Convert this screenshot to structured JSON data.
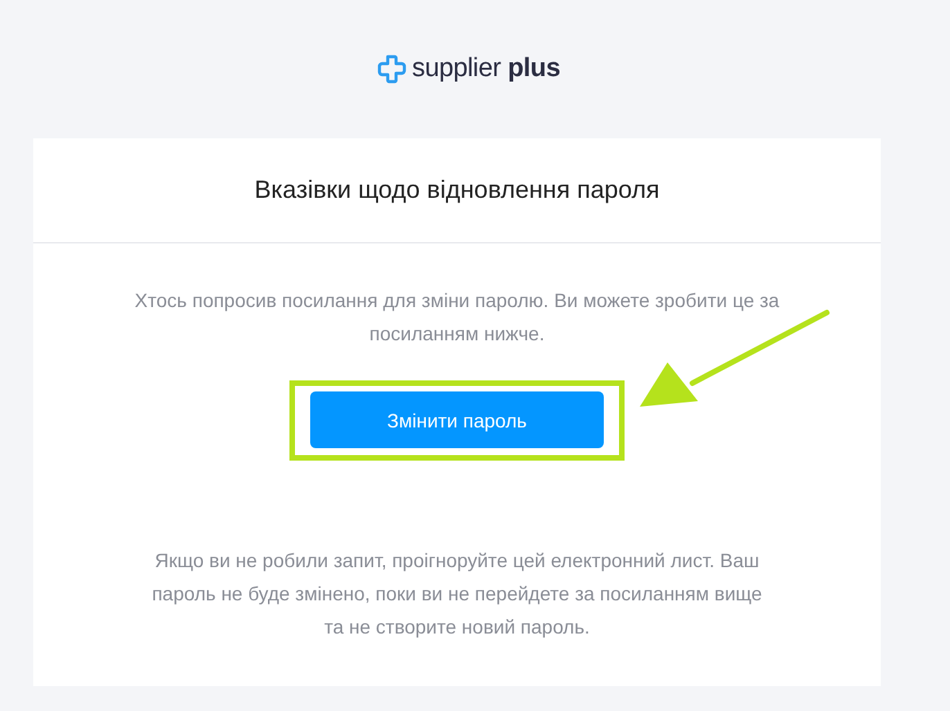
{
  "logo": {
    "text": "supplier **plus**"
  },
  "card": {
    "title": "Вказівки щодо відновлення пароля",
    "intro": "Хтось попросив посилання для зміни паролю. Ви можете зробити це за посиланням нижче.",
    "button": "Змінити пароль",
    "note": "Якщо ви не робили запит, проігноруйте цей електронний лист. Ваш пароль не буде змінено, поки ви не перейдете за посиланням вище та не створите новий пароль."
  },
  "annotation": {
    "highlight": true,
    "arrow": true
  }
}
